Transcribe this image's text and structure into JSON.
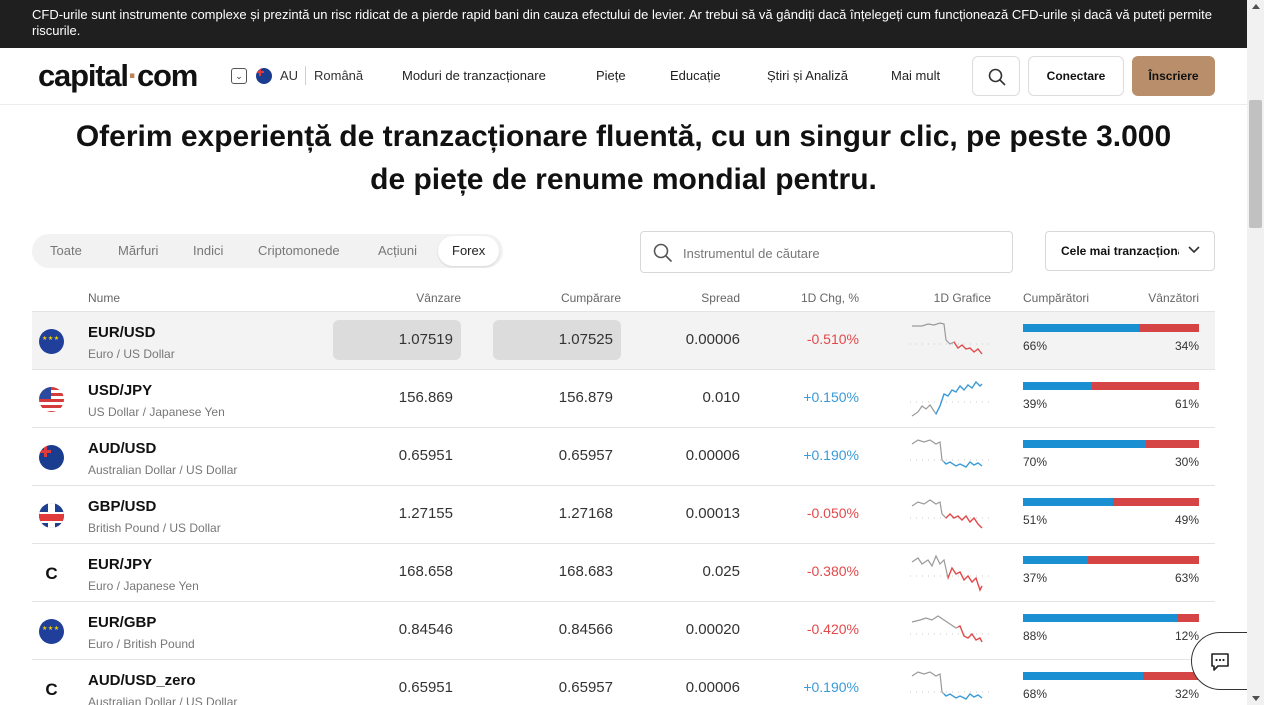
{
  "risk_warning": "CFD-urile sunt instrumente complexe și prezintă un risc ridicat de a pierde rapid bani din cauza efectului de levier. Ar trebui să vă gândiți dacă înțelegeți cum funcționează CFD-urile și dacă vă puteți permite riscurile.",
  "header": {
    "logo": {
      "text_main": "capital",
      "dot": "·",
      "text_end": "com"
    },
    "region_code": "AU",
    "language": "Română",
    "nav": [
      "Moduri de tranzacționare",
      "Piețe",
      "Educație",
      "Știri și Analiză",
      "Mai mult"
    ],
    "login_label": "Conectare",
    "signup_label": "Înscriere",
    "accent_color": "#b98f6b"
  },
  "hero": {
    "title_line1": "Oferim experiență de tranzacționare fluentă, cu un singur clic, pe peste 3.000",
    "title_line2": "de piețe de renume mondial pentru."
  },
  "filters": {
    "tabs": [
      "Toate",
      "Mărfuri",
      "Indici",
      "Criptomonede",
      "Acțiuni",
      "Forex"
    ],
    "active": "Forex"
  },
  "search": {
    "placeholder": "Instrumentul de căutare"
  },
  "sort": {
    "value": "Cele mai tranzacționate"
  },
  "table": {
    "headers": {
      "name": "Nume",
      "sell": "Vânzare",
      "buy": "Cumpărare",
      "spread": "Spread",
      "change": "1D Chg, %",
      "chart": "1D Grafice",
      "buyers": "Cumpărători",
      "sellers": "Vânzători"
    },
    "rows": [
      {
        "symbol": "EUR/USD",
        "name": "Euro / US Dollar",
        "flag": "eu",
        "sell": "1.07519",
        "buy": "1.07525",
        "spread": "0.00006",
        "change": "-0.510%",
        "dir": "neg",
        "buyers": "66%",
        "sellers": "34%",
        "buyers_fraction": 0.66
      },
      {
        "symbol": "USD/JPY",
        "name": "US Dollar / Japanese Yen",
        "flag": "us",
        "sell": "156.869",
        "buy": "156.879",
        "spread": "0.010",
        "change": "+0.150%",
        "dir": "pos",
        "buyers": "39%",
        "sellers": "61%",
        "buyers_fraction": 0.39
      },
      {
        "symbol": "AUD/USD",
        "name": "Australian Dollar / US Dollar",
        "flag": "au",
        "sell": "0.65951",
        "buy": "0.65957",
        "spread": "0.00006",
        "change": "+0.190%",
        "dir": "pos",
        "buyers": "70%",
        "sellers": "30%",
        "buyers_fraction": 0.7
      },
      {
        "symbol": "GBP/USD",
        "name": "British Pound / US Dollar",
        "flag": "gb",
        "sell": "1.27155",
        "buy": "1.27168",
        "spread": "0.00013",
        "change": "-0.050%",
        "dir": "neg",
        "buyers": "51%",
        "sellers": "49%",
        "buyers_fraction": 0.51
      },
      {
        "symbol": "EUR/JPY",
        "name": "Euro / Japanese Yen",
        "flag": "capital",
        "sell": "168.658",
        "buy": "168.683",
        "spread": "0.025",
        "change": "-0.380%",
        "dir": "neg",
        "buyers": "37%",
        "sellers": "63%",
        "buyers_fraction": 0.37
      },
      {
        "symbol": "EUR/GBP",
        "name": "Euro / British Pound",
        "flag": "eu",
        "sell": "0.84546",
        "buy": "0.84566",
        "spread": "0.00020",
        "change": "-0.420%",
        "dir": "neg",
        "buyers": "88%",
        "sellers": "12%",
        "buyers_fraction": 0.88
      },
      {
        "symbol": "AUD/USD_zero",
        "name": "Australian Dollar / US Dollar",
        "flag": "capital",
        "sell": "0.65951",
        "buy": "0.65957",
        "spread": "0.00006",
        "change": "+0.190%",
        "dir": "pos",
        "buyers": "68%",
        "sellers": "32%",
        "buyers_fraction": 0.68
      }
    ]
  },
  "colors": {
    "negative": "#e2494b",
    "positive": "#3a9ad8",
    "buyers_bar": "#1a8fd1",
    "sellers_bar": "#d64545"
  },
  "icons": {
    "search": "search-icon",
    "chevron": "chevron-down-icon",
    "chat": "chat-icon",
    "capital_flag_glyph": "C"
  }
}
